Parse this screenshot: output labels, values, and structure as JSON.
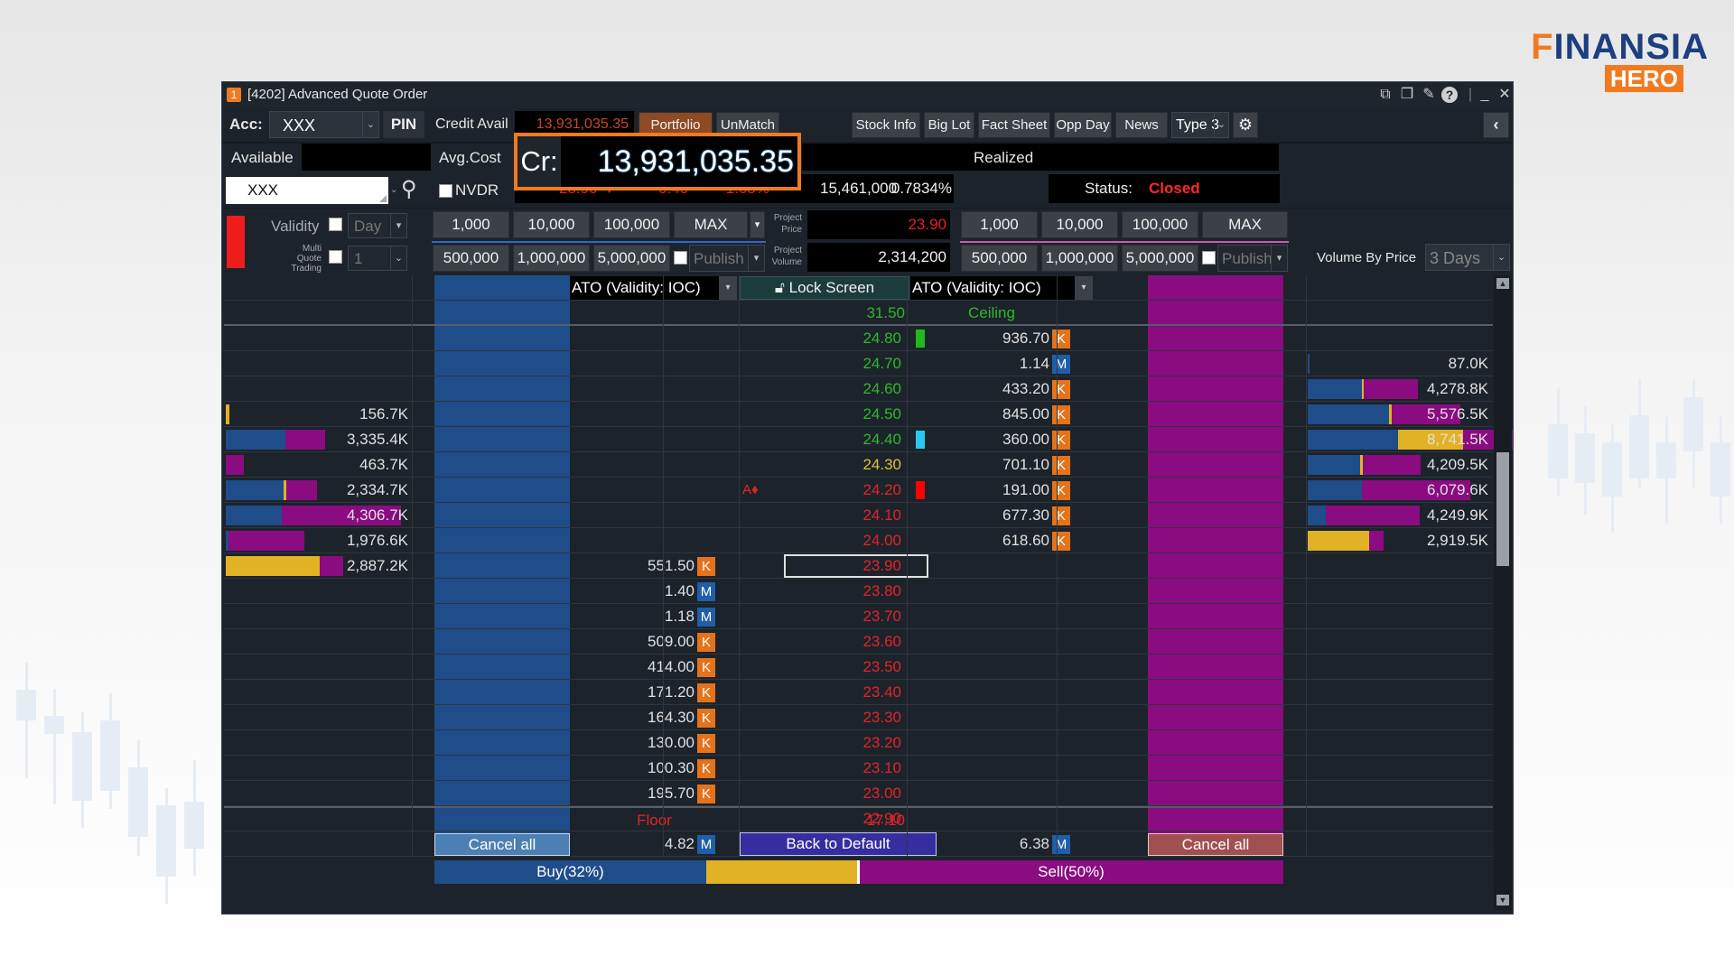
{
  "logo": {
    "word_prefix": "F",
    "word_rest": "INANSIA",
    "badge": "HERO"
  },
  "window": {
    "number": "1",
    "title": "[4202] Advanced Quote Order",
    "controls": [
      "popout-icon",
      "restore-icon",
      "pin-icon",
      "help-icon",
      "minimize-icon",
      "close-icon"
    ]
  },
  "toolbar": {
    "acc_label": "Acc:",
    "acc_value": "XXX",
    "pin_label": "PIN",
    "credit_avail_label": "Credit Avail",
    "credit_avail_value": "13,931,035.35",
    "portfolio_label": "Portfolio",
    "unmatch_label": "UnMatch",
    "buttons": [
      "Stock Info",
      "Big Lot",
      "Fact Sheet",
      "Opp Day",
      "News"
    ],
    "type_value": "Type 3",
    "collapse_icon": "chevron-left-icon"
  },
  "info": {
    "available_label": "Available",
    "available_value": "",
    "avg_cost_label": "Avg.Cost",
    "realized_label": "Realized",
    "realized_value": "",
    "cr_label": "Cr:",
    "cr_value": "13,931,035.35",
    "symbol_value": "XXX",
    "nvdr_label": "NVDR",
    "last_price": "23.90",
    "change": "0.40",
    "change_pct": "-1.65%",
    "volume": "15,461,000",
    "pct": "0.7834%",
    "status_label": "Status:",
    "status_value": "Closed"
  },
  "order": {
    "validity_label": "Validity",
    "validity_value": "Day",
    "multi_label_1": "Multi",
    "multi_label_2": "Quote Trading",
    "multi_value": "1",
    "buy_qty_row1": [
      "1,000",
      "10,000",
      "100,000",
      "MAX"
    ],
    "buy_qty_row2": [
      "500,000",
      "1,000,000",
      "5,000,000"
    ],
    "sell_qty_row1": [
      "1,000",
      "10,000",
      "100,000",
      "MAX"
    ],
    "sell_qty_row2": [
      "500,000",
      "1,000,000",
      "5,000,000"
    ],
    "publish_label": "Publish",
    "project_price_label_1": "Project",
    "project_price_label_2": "Price",
    "project_price": "23.90",
    "project_volume_label_1": "Project",
    "project_volume_label_2": "Volume",
    "project_volume": "2,314,200",
    "volume_by_price_label": "Volume By Price",
    "volume_by_price_period": "3 Days"
  },
  "ladder": {
    "buy_ato": "ATO (Validity: IOC)",
    "sell_ato": "ATO (Validity: IOC)",
    "lock_label": "Lock Screen",
    "ceiling_price": "31.50",
    "ceiling_label": "Ceiling",
    "floor_label": "Floor",
    "floor_price": "17.10",
    "rows": [
      {
        "price": "24.80",
        "color": "#2db82d",
        "ask": "936.70",
        "ask_unit": "K",
        "marker": "#1fb81f",
        "left_vol": "",
        "right_vol": ""
      },
      {
        "price": "24.70",
        "color": "#2db82d",
        "ask": "1.14",
        "ask_unit": "M",
        "marker": "",
        "left_vol": "",
        "right_vol": "87.0K",
        "right_bars": [
          0.005,
          0,
          0
        ]
      },
      {
        "price": "24.60",
        "color": "#2db82d",
        "ask": "433.20",
        "ask_unit": "K",
        "marker": "",
        "left_vol": "",
        "right_vol": "4,278.8K",
        "right_bars": [
          0.3,
          0.01,
          0.3
        ]
      },
      {
        "price": "24.50",
        "color": "#2db82d",
        "ask": "845.00",
        "ask_unit": "K",
        "marker": "",
        "left_vol": "156.7K",
        "left_bars": [
          0,
          0.02,
          0
        ],
        "right_vol": "5,576.5K",
        "right_bars": [
          0.45,
          0.015,
          0.38
        ]
      },
      {
        "price": "24.40",
        "color": "#2db82d",
        "ask": "360.00",
        "ask_unit": "K",
        "marker": "#28c8f0",
        "left_vol": "3,335.4K",
        "left_bars": [
          0.33,
          0,
          0.22
        ],
        "right_vol": "8,741.5K",
        "right_bars": [
          0.5,
          0.36,
          0.45
        ]
      },
      {
        "price": "24.30",
        "color": "#d8c23a",
        "ask": "701.10",
        "ask_unit": "K",
        "marker": "",
        "left_vol": "463.7K",
        "left_bars": [
          0,
          0,
          0.1
        ],
        "right_vol": "4,209.5K",
        "right_bars": [
          0.29,
          0.015,
          0.32
        ]
      },
      {
        "price": "24.20",
        "color": "#e0242a",
        "ask": "191.00",
        "ask_unit": "K",
        "marker": "#ff0000",
        "flag": "A♦",
        "left_vol": "2,334.7K",
        "left_bars": [
          0.32,
          0.015,
          0.17
        ],
        "right_vol": "6,079.6K",
        "right_bars": [
          0.3,
          0,
          0.6
        ]
      },
      {
        "price": "24.10",
        "color": "#e0242a",
        "ask": "677.30",
        "ask_unit": "K",
        "marker": "",
        "left_vol": "4,306.7K",
        "left_bars": [
          0.31,
          0,
          0.66
        ],
        "right_vol": "4,249.9K",
        "right_bars": [
          0.1,
          0,
          0.52
        ]
      },
      {
        "price": "24.00",
        "color": "#e0242a",
        "ask": "618.60",
        "ask_unit": "K",
        "marker": "",
        "left_vol": "1,976.6K",
        "left_bars": [
          0.01,
          0,
          0.42
        ],
        "right_vol": "2,919.5K",
        "right_bars": [
          0,
          0.34,
          0.08
        ]
      },
      {
        "price": "23.90",
        "color": "#e0242a",
        "bid": "551.50",
        "bid_unit": "K",
        "selected": true,
        "left_vol": "2,887.2K",
        "left_bars": [
          0,
          0.52,
          0.13
        ]
      },
      {
        "price": "23.80",
        "color": "#e0242a",
        "bid": "1.40",
        "bid_unit": "M"
      },
      {
        "price": "23.70",
        "color": "#e0242a",
        "bid": "1.18",
        "bid_unit": "M"
      },
      {
        "price": "23.60",
        "color": "#e0242a",
        "bid": "509.00",
        "bid_unit": "K"
      },
      {
        "price": "23.50",
        "color": "#e0242a",
        "bid": "414.00",
        "bid_unit": "K"
      },
      {
        "price": "23.40",
        "color": "#e0242a",
        "bid": "171.20",
        "bid_unit": "K"
      },
      {
        "price": "23.30",
        "color": "#e0242a",
        "bid": "164.30",
        "bid_unit": "K"
      },
      {
        "price": "23.20",
        "color": "#e0242a",
        "bid": "130.00",
        "bid_unit": "K"
      },
      {
        "price": "23.10",
        "color": "#e0242a",
        "bid": "100.30",
        "bid_unit": "K"
      },
      {
        "price": "23.00",
        "color": "#e0242a",
        "bid": "195.70",
        "bid_unit": "K"
      },
      {
        "price": "22.90",
        "color": "#e0242a"
      }
    ],
    "buy_cancel_label": "Cancel all",
    "sell_cancel_label": "Cancel all",
    "back_default_label": "Back to Default",
    "bid_total": "4.82",
    "bid_total_unit": "M",
    "ask_total": "6.38",
    "ask_total_unit": "M",
    "buy_label": "Buy(32%)",
    "sell_label": "Sell(50%)",
    "buy_pct": 32,
    "neutral_pct": 18,
    "sell_pct": 50
  },
  "colors": {
    "buy": "#1e4d8a",
    "sell": "#8a0c80",
    "neutral": "#e1b126",
    "accent": "#f07a20",
    "down": "#e0242a",
    "up": "#2db82d"
  }
}
